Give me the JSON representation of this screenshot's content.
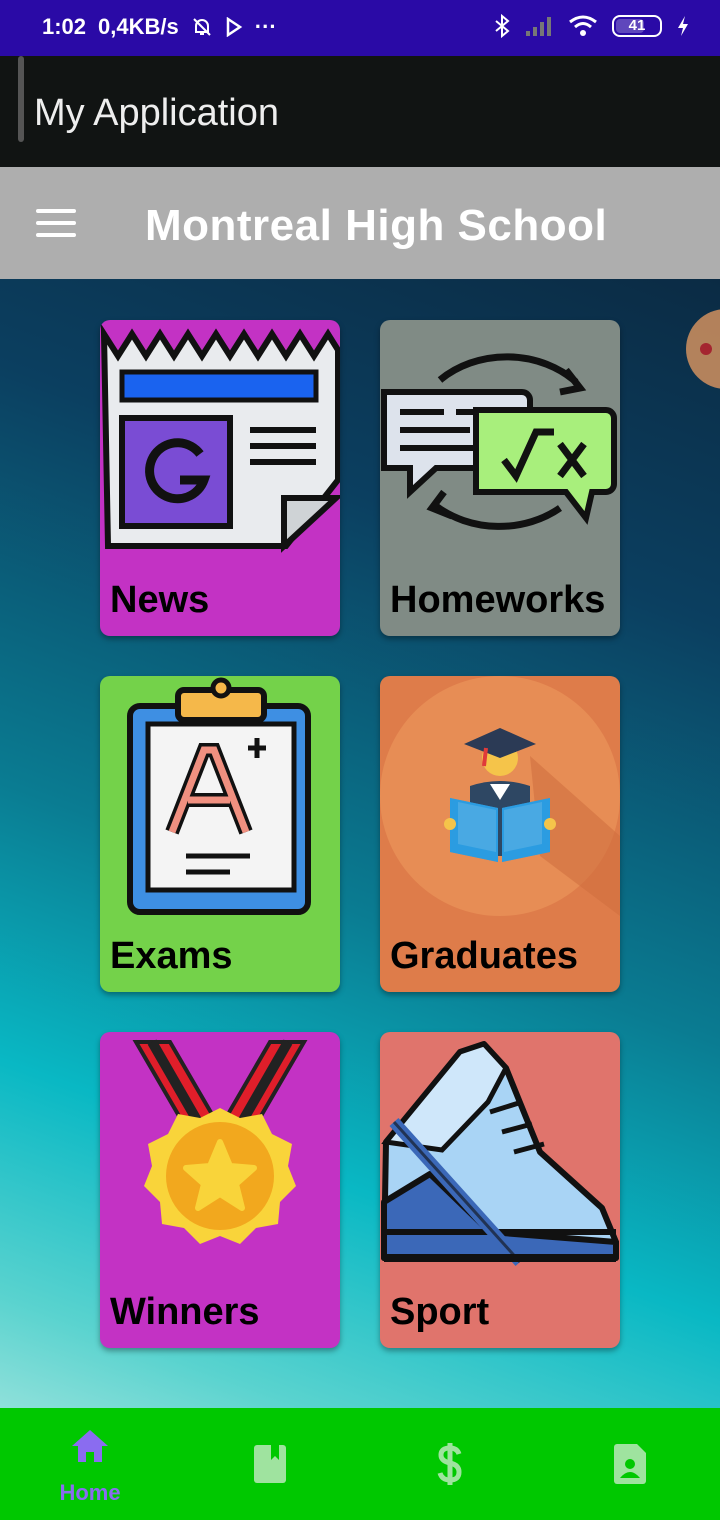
{
  "status_bar": {
    "time": "1:02",
    "speed": "0,4KB/s",
    "more": "···",
    "battery_level": "41"
  },
  "app_bar": {
    "title": "My Application"
  },
  "toolbar": {
    "title": "Montreal High School",
    "menu_icon": "hamburger-menu-icon"
  },
  "tiles": [
    {
      "label": "News",
      "color": "#c332c4",
      "icon": "newspaper-icon"
    },
    {
      "label": "Homeworks",
      "color": "#808b85",
      "icon": "chat-math-icon"
    },
    {
      "label": "Exams",
      "color": "#74d24a",
      "icon": "clipboard-grade-icon"
    },
    {
      "label": "Graduates",
      "color": "#de7c4a",
      "icon": "graduate-reading-icon"
    },
    {
      "label": "Winners",
      "color": "#c332c4",
      "icon": "medal-icon"
    },
    {
      "label": "Sport",
      "color": "#e0746c",
      "icon": "sneaker-icon"
    }
  ],
  "bottom_nav": {
    "background": "#00c800",
    "items": [
      {
        "label": "Home",
        "icon": "home-icon",
        "selected": true
      },
      {
        "label": "",
        "icon": "book-icon",
        "selected": false
      },
      {
        "label": "",
        "icon": "dollar-icon",
        "selected": false
      },
      {
        "label": "",
        "icon": "contact-file-icon",
        "selected": false
      }
    ]
  }
}
